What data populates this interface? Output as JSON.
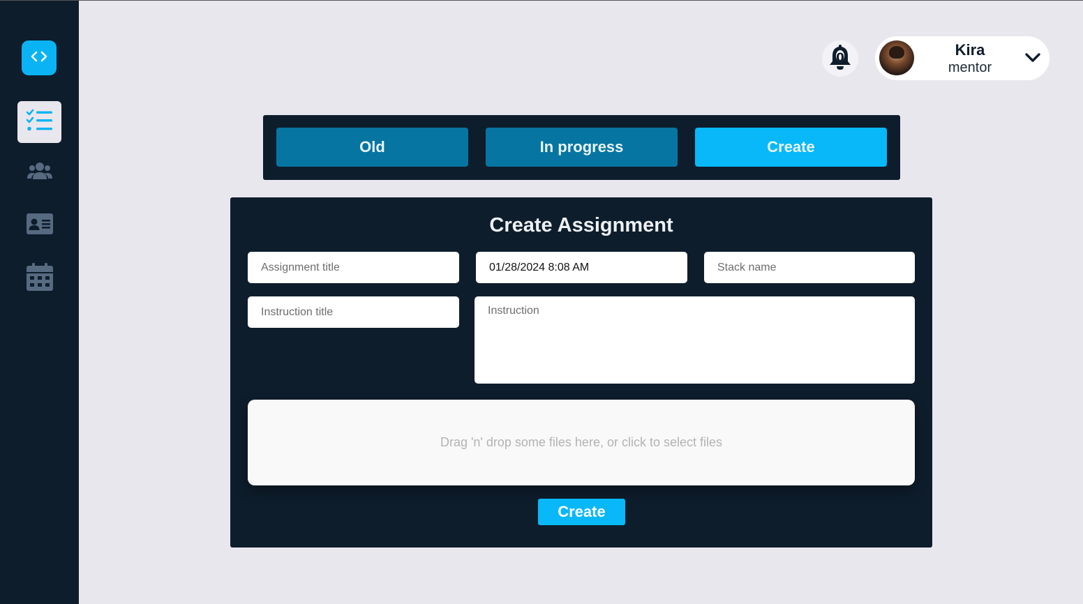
{
  "sidebar": {
    "logo_icon": "code-brackets-icon",
    "items": [
      {
        "name": "assignments",
        "icon": "checklist-icon",
        "active": true
      },
      {
        "name": "users",
        "icon": "users-group-icon",
        "active": false
      },
      {
        "name": "profile-card",
        "icon": "id-card-icon",
        "active": false
      },
      {
        "name": "calendar",
        "icon": "calendar-icon",
        "active": false
      }
    ]
  },
  "header": {
    "notifications_count": "0",
    "user": {
      "name": "Kira",
      "role": "mentor"
    }
  },
  "tabs": [
    {
      "label": "Old",
      "active": false
    },
    {
      "label": "In progress",
      "active": false
    },
    {
      "label": "Create",
      "active": true
    }
  ],
  "form": {
    "title": "Create Assignment",
    "assignment_title_placeholder": "Assignment title",
    "deadline_value": "01/28/2024 8:08 AM",
    "stack_name_placeholder": "Stack name",
    "instruction_title_placeholder": "Instruction title",
    "instruction_placeholder": "Instruction",
    "dropzone_text": "Drag 'n' drop some files here, or click to select files",
    "submit_label": "Create"
  },
  "colors": {
    "sidebar_bg": "#0e1d2c",
    "accent": "#08b8f8",
    "tab_muted": "#0775a1",
    "page_bg": "#e9e7ee"
  }
}
